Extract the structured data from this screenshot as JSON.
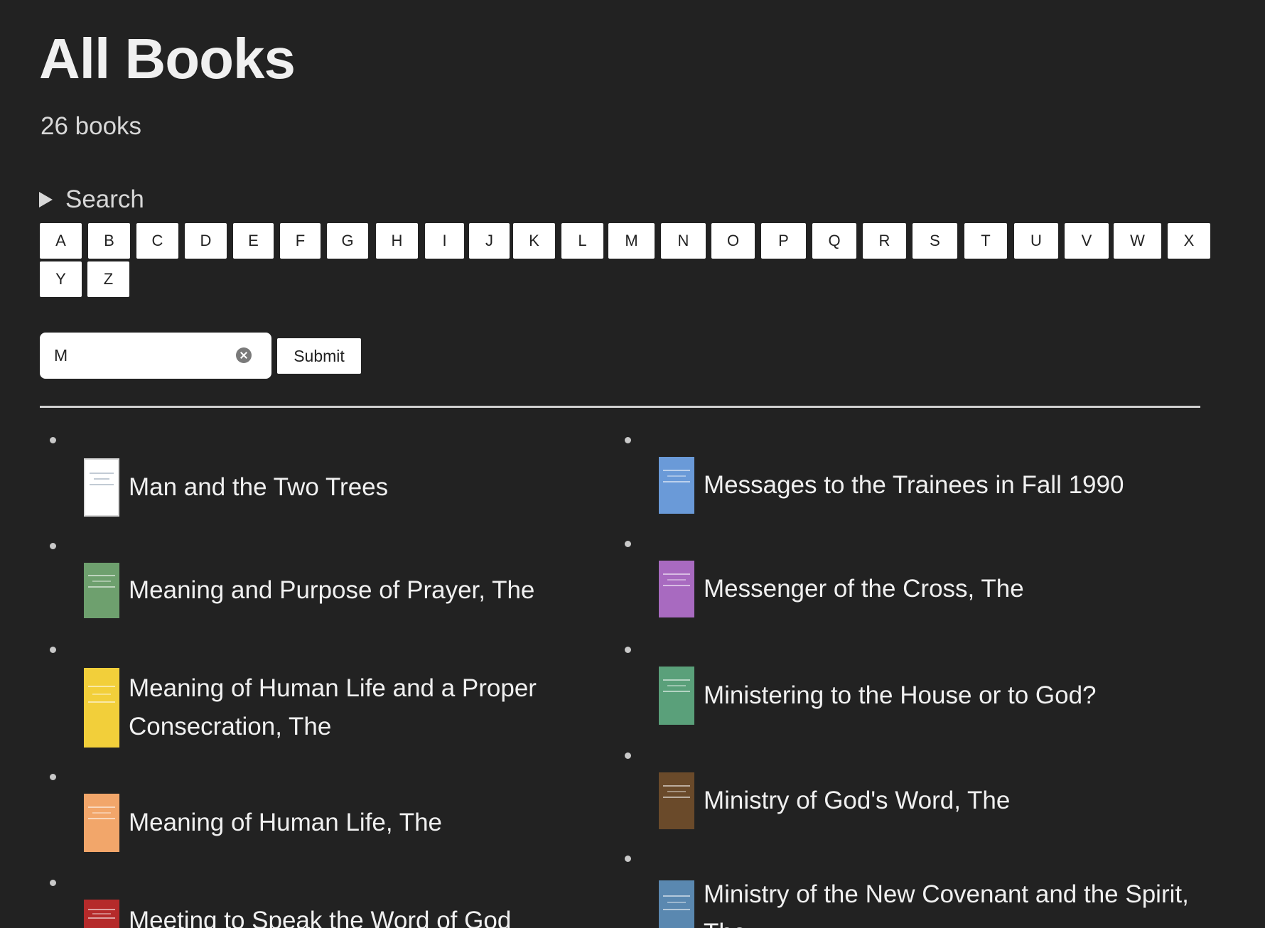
{
  "page": {
    "title": "All Books",
    "count": "26 books"
  },
  "search": {
    "toggle_label": "Search",
    "input_value": "M",
    "submit_label": "Submit"
  },
  "letters": [
    "A",
    "B",
    "C",
    "D",
    "E",
    "F",
    "G",
    "H",
    "I",
    "J",
    "K",
    "L",
    "M",
    "N",
    "O",
    "P",
    "Q",
    "R",
    "S",
    "T",
    "U",
    "V",
    "W",
    "X",
    "Y",
    "Z"
  ],
  "books": {
    "left": [
      {
        "title": "Man and the Two Trees",
        "cover_color": "#ffffff"
      },
      {
        "title": "Meaning and Purpose of Prayer, The",
        "cover_color": "#6ea06e"
      },
      {
        "title": "Meaning of Human Life and a Proper Consecration, The",
        "cover_color": "#f2cf3a"
      },
      {
        "title": "Meaning of Human Life, The",
        "cover_color": "#f2a66a"
      },
      {
        "title": "Meeting to Speak the Word of God",
        "cover_color": "#b52a2a"
      }
    ],
    "right": [
      {
        "title": "Messages to the Trainees in Fall 1990",
        "cover_color": "#6a9ad8"
      },
      {
        "title": "Messenger of the Cross, The",
        "cover_color": "#a86ac0"
      },
      {
        "title": "Ministering to the House or to God?",
        "cover_color": "#5aa07a"
      },
      {
        "title": "Ministry of God's Word, The",
        "cover_color": "#6a4a2a"
      },
      {
        "title": "Ministry of the New Covenant and the Spirit, The",
        "cover_color": "#5a88b0"
      }
    ]
  }
}
